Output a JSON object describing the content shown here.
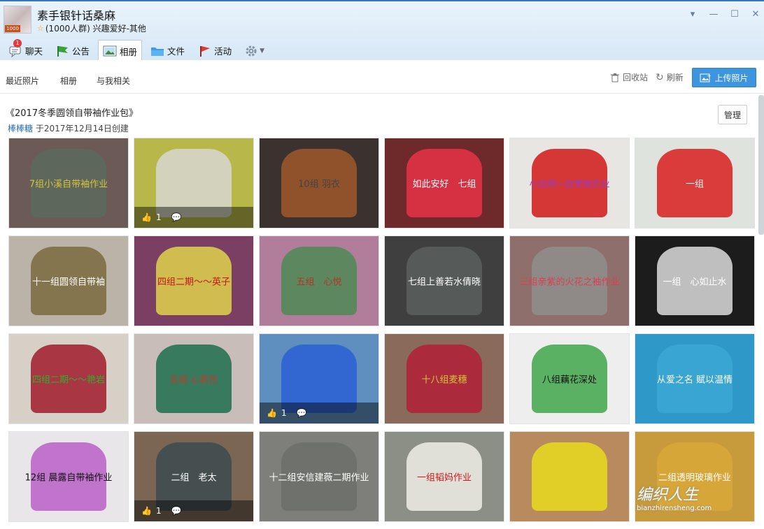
{
  "group": {
    "name": "素手银针话桑麻",
    "info": "(1000人群) 兴趣爱好-其他",
    "level_badge": "1000"
  },
  "tabs": [
    {
      "label": "聊天",
      "icon": "chat-icon",
      "badge": "1"
    },
    {
      "label": "公告",
      "icon": "flag-icon"
    },
    {
      "label": "相册",
      "icon": "photo-icon"
    },
    {
      "label": "文件",
      "icon": "folder-icon"
    },
    {
      "label": "活动",
      "icon": "activity-flag-icon"
    }
  ],
  "subnav": {
    "recent": "最近照片",
    "albums": "相册",
    "related": "与我相关",
    "recycle": "回收站",
    "refresh": "刷新",
    "upload": "上传照片"
  },
  "album": {
    "title": "《2017冬季圆领自带袖作业包》",
    "author": "棒棒糖",
    "created": "于2017年12月14日创建",
    "manage": "管理"
  },
  "photos": [
    {
      "caption": "7组小溪自带袖作业",
      "bg": "#6b5a55",
      "fg": "#d8c33a",
      "sw": "#5c6a5e"
    },
    {
      "caption": "",
      "bg": "#b8b84a",
      "fg": "#6b3e8a",
      "sw": "#d7d6d0",
      "likes": "1"
    },
    {
      "caption": "10组 羽衣",
      "bg": "#3b3230",
      "fg": "#444",
      "sw": "#a0582a"
    },
    {
      "caption": "如此安好　七组",
      "bg": "#6e2a2a",
      "fg": "#ffffff",
      "sw": "#e83246"
    },
    {
      "caption": "小白杨~自带袖作业",
      "bg": "#e8e6e3",
      "fg": "#9a3cc0",
      "sw": "#d11717"
    },
    {
      "caption": "一组",
      "bg": "#dfe3de",
      "fg": "#f4f4f4",
      "sw": "#d81e1e"
    },
    {
      "caption": "十一组圆领自带袖",
      "bg": "#bcb3a8",
      "fg": "#ffffff",
      "sw": "#7b6a3e"
    },
    {
      "caption": "四组二期～～英子",
      "bg": "#7a3f63",
      "fg": "#c41515",
      "sw": "#e1d24b"
    },
    {
      "caption": "五组　心悦",
      "bg": "#b07e9b",
      "fg": "#b0352a",
      "sw": "#4f8a55"
    },
    {
      "caption": "七组上善若水倩晓",
      "bg": "#3f3f3f",
      "fg": "#ffffff",
      "sw": "#5b5f5d"
    },
    {
      "caption": "三组亲紫的火花之袖作业",
      "bg": "#8f6f6c",
      "fg": "#d84050",
      "sw": "#8f8f8c"
    },
    {
      "caption": "一组　心如止水",
      "bg": "#1c1c1c",
      "fg": "#ffffff",
      "sw": "#dcdcdc"
    },
    {
      "caption": "四组二期～～艳岩",
      "bg": "#d6d0c7",
      "fg": "#2fae2f",
      "sw": "#a01c2c"
    },
    {
      "caption": "五组 心若在",
      "bg": "#c9bdba",
      "fg": "#c23a2a",
      "sw": "#1f6e4d"
    },
    {
      "caption": "",
      "bg": "#5f8fbe",
      "fg": "#fff",
      "sw": "#2a5fd4",
      "likes": "1"
    },
    {
      "caption": "十八组麦穗",
      "bg": "#8a6a5a",
      "fg": "#d7c43a",
      "sw": "#b01e36"
    },
    {
      "caption": "八组藕花深处",
      "bg": "#eeeeee",
      "fg": "#111111",
      "sw": "#3fa44a"
    },
    {
      "caption": "从爱之名 赋以温情",
      "bg": "#2e98c8",
      "fg": "#ffffff",
      "sw": "#39a7d4"
    },
    {
      "caption": "12组 晨露自带袖作业",
      "bg": "#e8e6e8",
      "fg": "#111111",
      "sw": "#b85fc6"
    },
    {
      "caption": "二组　老太",
      "bg": "#7a6652",
      "fg": "#ffffff",
      "sw": "#3c4b50",
      "likes": "1"
    },
    {
      "caption": "十二组安信建薇二期作业",
      "bg": "#7e7e7a",
      "fg": "#ffffff",
      "sw": "#6b6e6a"
    },
    {
      "caption": "一组韬妈作业",
      "bg": "#8b8f86",
      "fg": "#d11a1a",
      "sw": "#f0efe6"
    },
    {
      "caption": "",
      "bg": "#b88a5d",
      "fg": "#fff",
      "sw": "#e8da1e"
    },
    {
      "caption": "二组透明玻璃作业",
      "bg": "#c79a3b",
      "fg": "#ffffff",
      "sw": "#d8a838"
    }
  ],
  "watermark": {
    "brand": "编织人生",
    "url": "bianzhirensheng.com"
  },
  "colors": {
    "accent": "#3d95e0",
    "link": "#2a6db7",
    "title_bar": "#d7e8f6"
  }
}
